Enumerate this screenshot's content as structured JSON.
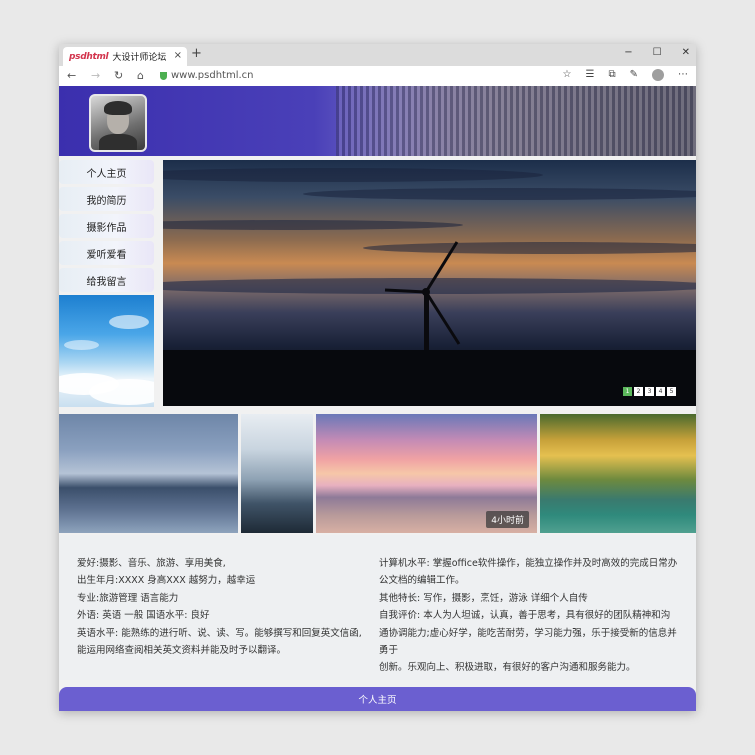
{
  "browser": {
    "tab_logo": "psdhtml",
    "tab_title": "大设计师论坛",
    "tab_close": "×",
    "new_tab": "+",
    "url": "www.psdhtml.cn",
    "min": "−",
    "max": "☐",
    "close": "✕"
  },
  "menu": {
    "items": [
      "个人主页",
      "我的简历",
      "摄影作品",
      "爱听爱看",
      "给我留言"
    ]
  },
  "slider": {
    "dots": [
      "1",
      "2",
      "3",
      "4",
      "5"
    ]
  },
  "gallery": {
    "badge": "4小时前"
  },
  "info": {
    "left": [
      "爱好:摄影、音乐、旅游、享用美食,",
      "出生年月:XXXX 身高XXX   越努力，越幸运",
      "专业:旅游管理 语言能力",
      "外语:   英语   一般       国语水平:   良好",
      "英语水平:           能熟练的进行听、说、读、写。能够撰写和回复英文信函,",
      "能运用网络查阅相关英文资料并能及时予以翻译。"
    ],
    "right": [
      "计算机水平:           掌握office软件操作，能独立操作并及时高效的完成日常办",
      "公文档的编辑工作。",
      "其他特长:           写作，摄影，烹饪，游泳           详细个人自传",
      "自我评价:           本人为人坦诚，认真，善于思考，具有很好的团队精神和沟",
      "通协调能力;虚心好学，能吃苦耐劳，学习能力强，乐于接受新的信息并勇于",
      "创新。乐观向上、积极进取，有很好的客户沟通和服务能力。"
    ]
  },
  "footer": {
    "label": "个人主页"
  }
}
